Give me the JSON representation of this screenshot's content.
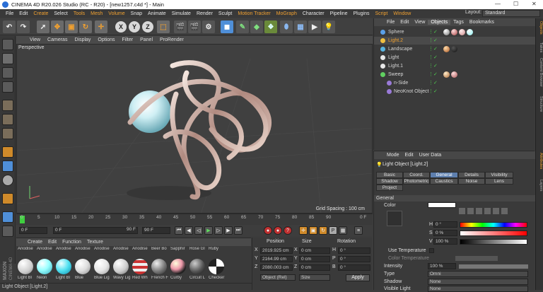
{
  "titlebar": {
    "title": "CINEMA 4D R20.026 Studio (RC - R20) - [new1257.c4d *] - Main",
    "min": "—",
    "max": "☐",
    "close": "✕"
  },
  "menubar": [
    "File",
    "Edit",
    "Create",
    "Select",
    "Tools",
    "Mesh",
    "Volume",
    "Snap",
    "Animate",
    "Simulate",
    "Render",
    "Sculpt",
    "Motion Tracker",
    "MoGraph",
    "Character",
    "Pipeline",
    "Plugins",
    "Script",
    "Window"
  ],
  "layout": {
    "label": "Layout:",
    "value": "Standard"
  },
  "toolbar": {
    "x": "X",
    "y": "Y",
    "z": "Z"
  },
  "viewport": {
    "menu": [
      "View",
      "Cameras",
      "Display",
      "Options",
      "Filter",
      "Panel",
      "ProRender"
    ],
    "label": "Perspective",
    "grid_spacing": "Grid Spacing : 100 cm"
  },
  "timeline": {
    "ticks": [
      "0",
      "5",
      "10",
      "15",
      "20",
      "25",
      "30",
      "35",
      "40",
      "45",
      "50",
      "55",
      "60",
      "65",
      "70",
      "75",
      "80",
      "85",
      "90"
    ],
    "end_label": "0 F"
  },
  "playbar": {
    "current": "0 F",
    "start": "0 F",
    "end": "90 F",
    "max": "90 F"
  },
  "materials": {
    "menu": [
      "Create",
      "Edit",
      "Function",
      "Texture"
    ],
    "row1": [
      "Anodise",
      "Anodise",
      "Anodise",
      "Anodise",
      "Anodise",
      "Anodise",
      "Anodise",
      "Beer Bo",
      "Sapphir",
      "Rose Gl",
      "Ruby"
    ],
    "row2": [
      "Light Bl",
      "Neon",
      "Light Bl",
      "Blue",
      "Blue Lig",
      "Wavy Lig",
      "Red Wh",
      "French F",
      "Curby",
      "Circuit L",
      "Checker"
    ]
  },
  "coordinates": {
    "headers": [
      "Position",
      "Size",
      "Rotation"
    ],
    "rows": [
      {
        "axis": "X",
        "pos": "2019.925 cm",
        "size": "0 cm",
        "rlabel": "H",
        "rot": "0 °"
      },
      {
        "axis": "Y",
        "pos": "2164.99 cm",
        "size": "0 cm",
        "rlabel": "P",
        "rot": "0 °"
      },
      {
        "axis": "Z",
        "pos": "2080.003 cm",
        "size": "0 cm",
        "rlabel": "B",
        "rot": "0 °"
      }
    ],
    "mode": "Object (Rel)",
    "size_mode": "Size",
    "apply": "Apply"
  },
  "objects": {
    "menu": [
      "File",
      "Edit",
      "View",
      "Objects",
      "Tags",
      "Bookmarks"
    ],
    "items": [
      {
        "name": "Sphere",
        "color": "#5aa0e8"
      },
      {
        "name": "Light.2",
        "color": "#f0c040"
      },
      {
        "name": "Landscape",
        "color": "#58b4e0"
      },
      {
        "name": "Light",
        "color": "#e8e8e8"
      },
      {
        "name": "Light.1",
        "color": "#e8e8e8"
      },
      {
        "name": "Sweep",
        "color": "#60d060"
      },
      {
        "name": "n-Side",
        "color": "#9a7ad8"
      },
      {
        "name": "NeoKnot Object",
        "color": "#9a7ad8"
      }
    ]
  },
  "attributes": {
    "menu": [
      "Mode",
      "Edit",
      "User Data"
    ],
    "title": "Light Object [Light.2]",
    "tabs": [
      "Basic",
      "Coord.",
      "General",
      "Details",
      "Visibility",
      "Shadow",
      "Photometric",
      "Caustics",
      "Noise",
      "Lens",
      "Project"
    ],
    "section": "General",
    "color_label": "Color",
    "h": "H",
    "h_val": "0 °",
    "s": "S",
    "s_val": "0 %",
    "v": "V",
    "v_val": "100 %",
    "use_temp": "Use Temperature",
    "color_temp": "Color Temperature",
    "intensity": "Intensity",
    "intensity_val": "100 %",
    "type": "Type",
    "type_val": "Omni",
    "shadow": "Shadow",
    "shadow_val": "None",
    "visible_light": "Visible Light",
    "visible_val": "None"
  },
  "sidetabs": [
    "Objects",
    "Takes",
    "Content Browser",
    "Structure",
    "Attributes",
    "Layers"
  ],
  "status": "Light Object [Light.2]",
  "colors": {
    "accent": "#f0a030",
    "active_tab": "#5d7fae",
    "check": "#4fcf4f"
  }
}
